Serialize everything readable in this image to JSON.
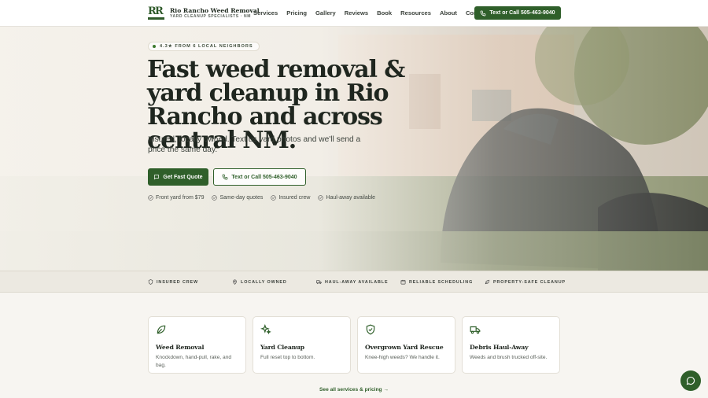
{
  "brand": {
    "mark": "RR",
    "name": "Rio Rancho Weed Removal",
    "tagline": "YARD CLEANUP SPECIALISTS · NM"
  },
  "nav": {
    "items": [
      "Services",
      "Pricing",
      "Gallery",
      "Reviews",
      "Book",
      "Resources",
      "About",
      "Contact"
    ],
    "call_label": "Text or Call 505-463-9040"
  },
  "hero": {
    "rating": "4.3★ FROM 6 LOCAL NEIGHBORS",
    "headline": "Fast weed removal & yard cleanup in Rio Rancho and across central NM.",
    "subcopy": "Insured, locally owned. Text us yard photos and we'll send a price the same day.",
    "primary_cta": "Get Fast Quote",
    "secondary_cta": "Text or Call 505-463-9040",
    "checks": [
      "Front yard from $79",
      "Same-day quotes",
      "Insured crew",
      "Haul-away available"
    ]
  },
  "strip": {
    "items": [
      {
        "label": "INSURED CREW",
        "icon": "shield-icon"
      },
      {
        "label": "LOCALLY OWNED",
        "icon": "map-pin-icon"
      },
      {
        "label": "HAUL-AWAY AVAILABLE",
        "icon": "truck-icon"
      },
      {
        "label": "RELIABLE SCHEDULING",
        "icon": "calendar-icon"
      },
      {
        "label": "PROPERTY-SAFE CLEANUP",
        "icon": "leaf-icon"
      }
    ]
  },
  "services": {
    "cards": [
      {
        "title": "Weed Removal",
        "desc": "Knockdown, hand-pull, rake, and bag.",
        "icon": "leaf-icon"
      },
      {
        "title": "Yard Cleanup",
        "desc": "Full reset top to bottom.",
        "icon": "sparkles-icon"
      },
      {
        "title": "Overgrown Yard Rescue",
        "desc": "Knee-high weeds? We handle it.",
        "icon": "shield-check-icon"
      },
      {
        "title": "Debris Haul-Away",
        "desc": "Weeds and brush trucked off-site.",
        "icon": "truck-icon"
      }
    ],
    "see_all": "See all services & pricing →"
  },
  "colors": {
    "brand_green": "#2f5f2a",
    "background": "#f7f5f1"
  }
}
